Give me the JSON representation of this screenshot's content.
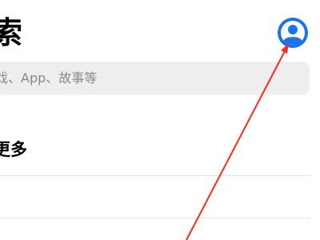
{
  "header": {
    "title": "索",
    "account_icon": "person-circle-icon"
  },
  "search": {
    "placeholder": "戏、App、故事等"
  },
  "section": {
    "title": "更多"
  },
  "colors": {
    "accent": "#1a73e8",
    "annotation": "#ff2a1a",
    "search_bg": "#eeeeef",
    "placeholder": "#8a8a8e",
    "divider": "#e2e2e6"
  }
}
